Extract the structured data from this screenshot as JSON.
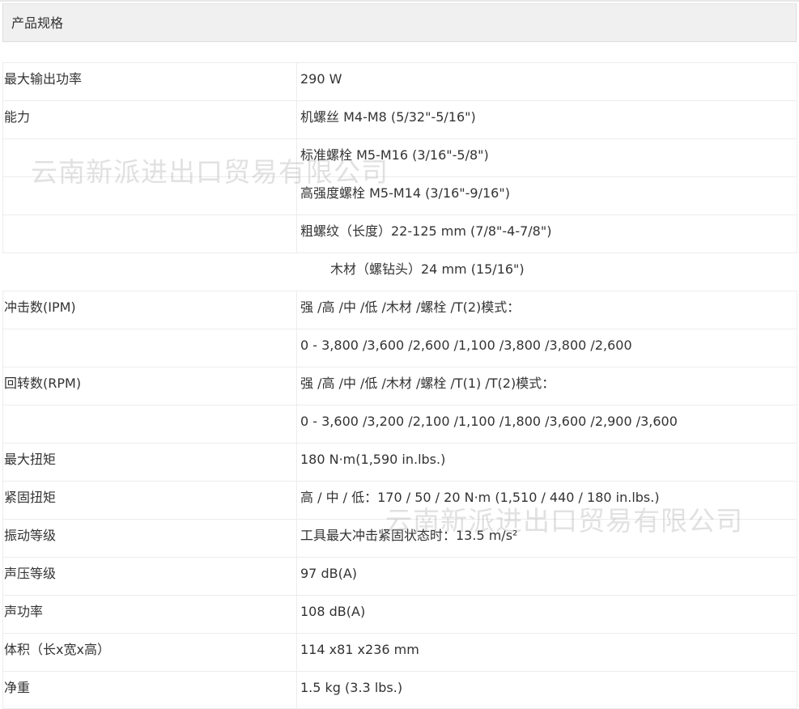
{
  "header": {
    "title": "产品规格"
  },
  "specs": [
    {
      "label": "最大输出功率",
      "value": "290 W"
    },
    {
      "label": "能力",
      "value": "机螺丝 M4-M8 (5/32\"-5/16\")"
    },
    {
      "label": "",
      "value": "标准螺栓 M5-M16 (3/16\"-5/8\")"
    },
    {
      "label": "",
      "value": "高强度螺栓 M5-M14 (3/16\"-9/16\")"
    },
    {
      "label": "",
      "value": "粗螺纹（长度）22-125 mm (7/8\"-4-7/8\")"
    },
    {
      "label": "",
      "value": "木材（螺钻头）24 mm (15/16\")"
    },
    {
      "label": "冲击数(IPM)",
      "value": "强 /高 /中 /低 /木材 /螺栓 /T(2)模式："
    },
    {
      "label": "",
      "value": "0 - 3,800 /3,600 /2,600 /1,100 /3,800 /3,800 /2,600"
    },
    {
      "label": "回转数(RPM)",
      "value": "强 /高 /中 /低 /木材 /螺栓 /T(1) /T(2)模式："
    },
    {
      "label": "",
      "value": "0 - 3,600 /3,200 /2,100 /1,100 /1,800 /3,600 /2,900 /3,600"
    },
    {
      "label": "最大扭矩",
      "value": "180 N·m(1,590 in.lbs.)"
    },
    {
      "label": "紧固扭矩",
      "value": "高 / 中 / 低：170 / 50 / 20 N·m (1,510 / 440 / 180 in.lbs.)"
    },
    {
      "label": "振动等级",
      "value": "工具最大冲击紧固状态时：13.5 m/s²"
    },
    {
      "label": "声压等级",
      "value": "97 dB(A)"
    },
    {
      "label": "声功率",
      "value": "108 dB(A)"
    },
    {
      "label": "体积（长x宽x高）",
      "value": "114 x81 x236 mm"
    },
    {
      "label": "净重",
      "value": "1.5 kg (3.3 lbs.)"
    }
  ],
  "watermark": {
    "text": "云南新派进出口贸易有限公司"
  }
}
